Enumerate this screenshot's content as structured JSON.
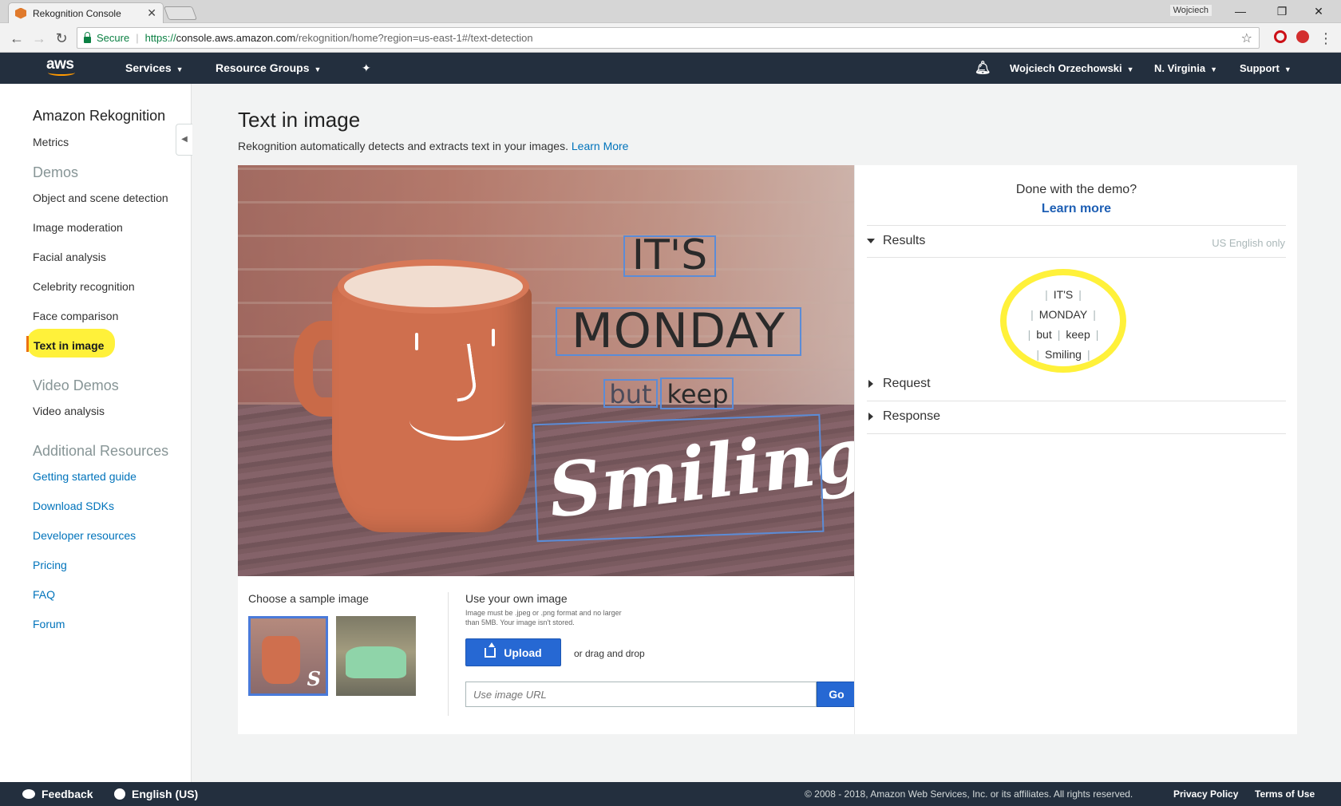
{
  "browser": {
    "tab_title": "Rekognition Console",
    "tab_close": "✕",
    "window_user": "Wojciech",
    "secure_label": "Secure",
    "url_scheme": "https://",
    "url_host": "console.aws.amazon.com",
    "url_path": "/rekognition/home?region=us-east-1#/text-detection",
    "icons": [
      "back-icon",
      "forward-icon",
      "reload-icon",
      "lock-icon",
      "star-icon",
      "minimize-icon",
      "restore-icon",
      "close-icon"
    ]
  },
  "aws_header": {
    "logo": "aws",
    "services": "Services",
    "resource_groups": "Resource Groups",
    "user": "Wojciech Orzechowski",
    "region": "N. Virginia",
    "support": "Support"
  },
  "sidebar": {
    "title": "Amazon Rekognition",
    "metrics": "Metrics",
    "demos_heading": "Demos",
    "demos": [
      "Object and scene detection",
      "Image moderation",
      "Facial analysis",
      "Celebrity recognition",
      "Face comparison",
      "Text in image"
    ],
    "video_heading": "Video Demos",
    "video_analysis": "Video analysis",
    "resources_heading": "Additional Resources",
    "resources": [
      "Getting started guide",
      "Download SDKs",
      "Developer resources",
      "Pricing",
      "FAQ",
      "Forum"
    ]
  },
  "main": {
    "title": "Text in image",
    "description": "Rekognition automatically detects and extracts text in your images.",
    "learn_more": "Learn More",
    "image_words": [
      "IT'S",
      "MONDAY",
      "but",
      "keep",
      "Smiling"
    ],
    "sample_label": "Choose a sample image",
    "own_title": "Use your own image",
    "own_note": "Image must be .jpeg or .png format and no larger than 5MB. Your image isn't stored.",
    "upload": "Upload",
    "drag": "or drag and drop",
    "url_placeholder": "Use image URL",
    "go": "Go"
  },
  "results": {
    "done": "Done with the demo?",
    "learn_more": "Learn more",
    "results_label": "Results",
    "lang_note": "US English only",
    "lines": [
      [
        "IT'S"
      ],
      [
        "MONDAY"
      ],
      [
        "but",
        "keep"
      ],
      [
        "Smiling"
      ]
    ],
    "separator": "|",
    "request_label": "Request",
    "response_label": "Response"
  },
  "footer": {
    "feedback": "Feedback",
    "language": "English (US)",
    "copyright": "© 2008 - 2018, Amazon Web Services, Inc. or its affiliates. All rights reserved.",
    "privacy": "Privacy Policy",
    "terms": "Terms of Use"
  },
  "colors": {
    "aws_nav": "#232f3e",
    "link_blue": "#0073bb",
    "button_blue": "#2668d3",
    "highlight_yellow": "#fff13a",
    "bbox_blue": "#5b8cd7"
  }
}
